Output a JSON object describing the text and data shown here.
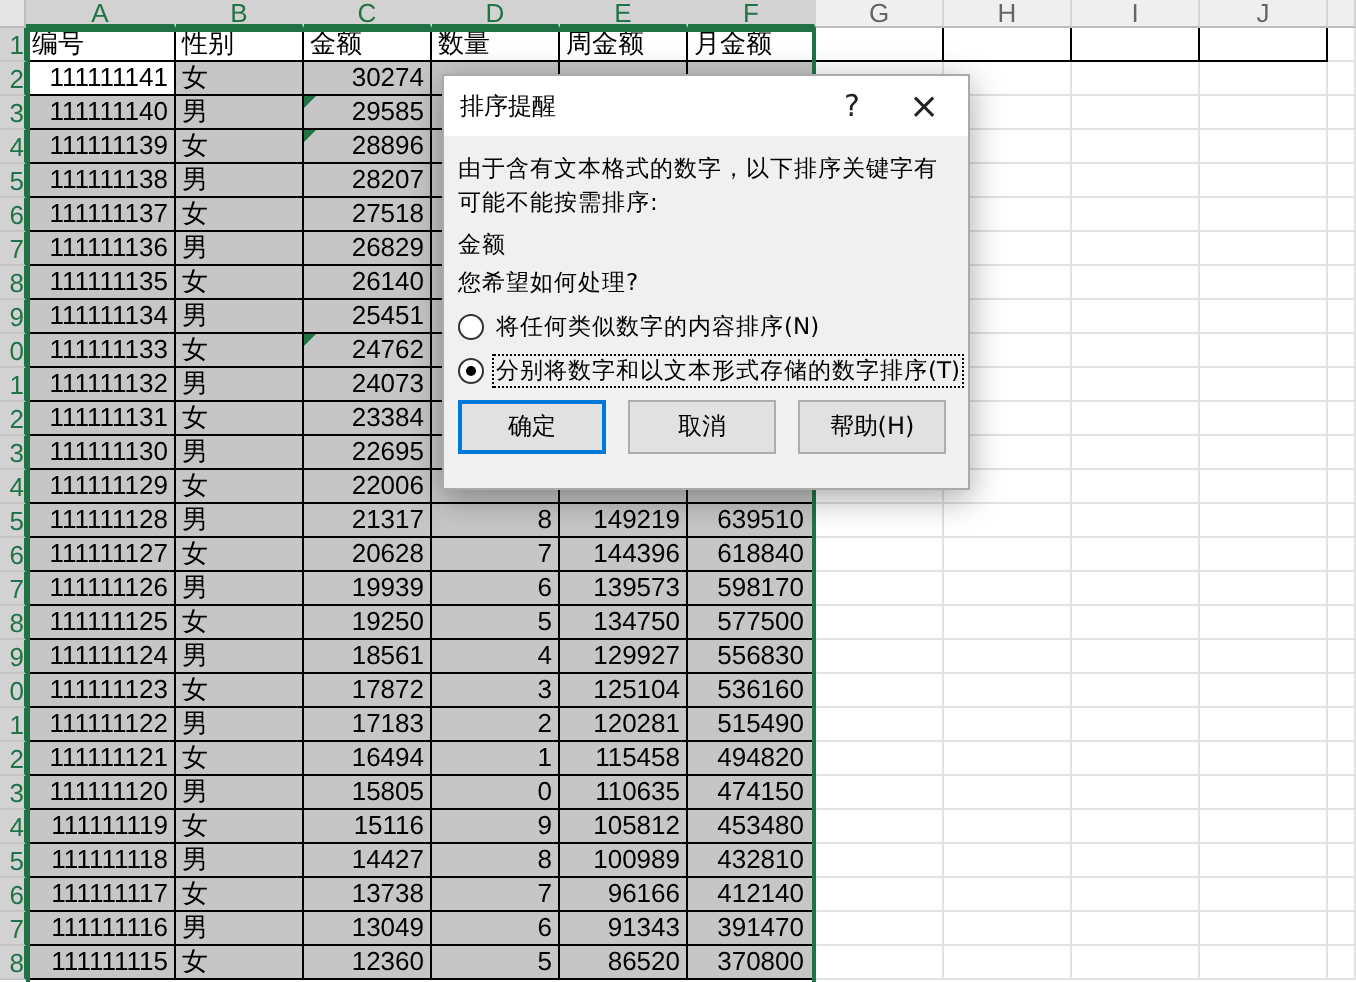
{
  "sheet": {
    "columns": [
      {
        "label": "A",
        "selected": true
      },
      {
        "label": "B",
        "selected": true
      },
      {
        "label": "C",
        "selected": true
      },
      {
        "label": "D",
        "selected": true
      },
      {
        "label": "E",
        "selected": true
      },
      {
        "label": "F",
        "selected": true
      },
      {
        "label": "G",
        "selected": false
      },
      {
        "label": "H",
        "selected": false
      },
      {
        "label": "I",
        "selected": false
      },
      {
        "label": "J",
        "selected": false
      }
    ],
    "header": {
      "row_number": "1",
      "cells": [
        "编号",
        "性别",
        "金额",
        "数量",
        "周金额",
        "月金额"
      ]
    },
    "rows": [
      {
        "row_number": "2",
        "active": true,
        "cells": [
          "111111141",
          "女",
          "30274"
        ],
        "text_number": false
      },
      {
        "row_number": "3",
        "active": false,
        "cells": [
          "111111140",
          "男",
          "29585"
        ],
        "text_number": true
      },
      {
        "row_number": "4",
        "active": false,
        "cells": [
          "111111139",
          "女",
          "28896"
        ],
        "text_number": true
      },
      {
        "row_number": "5",
        "active": false,
        "cells": [
          "111111138",
          "男",
          "28207"
        ],
        "text_number": false
      },
      {
        "row_number": "6",
        "active": false,
        "cells": [
          "111111137",
          "女",
          "27518"
        ],
        "text_number": false
      },
      {
        "row_number": "7",
        "active": false,
        "cells": [
          "111111136",
          "男",
          "26829"
        ],
        "text_number": false
      },
      {
        "row_number": "8",
        "active": false,
        "cells": [
          "111111135",
          "女",
          "26140"
        ],
        "text_number": false
      },
      {
        "row_number": "9",
        "active": false,
        "cells": [
          "111111134",
          "男",
          "25451"
        ],
        "text_number": false
      },
      {
        "row_number": "0",
        "active": false,
        "cells": [
          "111111133",
          "女",
          "24762"
        ],
        "text_number": true
      },
      {
        "row_number": "1",
        "active": false,
        "cells": [
          "111111132",
          "男",
          "24073"
        ],
        "text_number": false
      },
      {
        "row_number": "2",
        "active": false,
        "cells": [
          "111111131",
          "女",
          "23384"
        ],
        "text_number": false
      },
      {
        "row_number": "3",
        "active": false,
        "cells": [
          "111111130",
          "男",
          "22695"
        ],
        "text_number": false
      },
      {
        "row_number": "4",
        "active": false,
        "cells": [
          "111111129",
          "女",
          "22006"
        ],
        "text_number": false
      },
      {
        "row_number": "5",
        "active": false,
        "cells": [
          "111111128",
          "男",
          "21317",
          "8",
          "149219",
          "639510"
        ],
        "text_number": false
      },
      {
        "row_number": "6",
        "active": false,
        "cells": [
          "111111127",
          "女",
          "20628",
          "7",
          "144396",
          "618840"
        ],
        "text_number": false
      },
      {
        "row_number": "7",
        "active": false,
        "cells": [
          "111111126",
          "男",
          "19939",
          "6",
          "139573",
          "598170"
        ],
        "text_number": false
      },
      {
        "row_number": "8",
        "active": false,
        "cells": [
          "111111125",
          "女",
          "19250",
          "5",
          "134750",
          "577500"
        ],
        "text_number": false
      },
      {
        "row_number": "9",
        "active": false,
        "cells": [
          "111111124",
          "男",
          "18561",
          "4",
          "129927",
          "556830"
        ],
        "text_number": false
      },
      {
        "row_number": "0",
        "active": false,
        "cells": [
          "111111123",
          "女",
          "17872",
          "3",
          "125104",
          "536160"
        ],
        "text_number": false
      },
      {
        "row_number": "1",
        "active": false,
        "cells": [
          "111111122",
          "男",
          "17183",
          "2",
          "120281",
          "515490"
        ],
        "text_number": false
      },
      {
        "row_number": "2",
        "active": false,
        "cells": [
          "111111121",
          "女",
          "16494",
          "1",
          "115458",
          "494820"
        ],
        "text_number": false
      },
      {
        "row_number": "3",
        "active": false,
        "cells": [
          "111111120",
          "男",
          "15805",
          "0",
          "110635",
          "474150"
        ],
        "text_number": false
      },
      {
        "row_number": "4",
        "active": false,
        "cells": [
          "111111119",
          "女",
          "15116",
          "9",
          "105812",
          "453480"
        ],
        "text_number": false
      },
      {
        "row_number": "5",
        "active": false,
        "cells": [
          "111111118",
          "男",
          "14427",
          "8",
          "100989",
          "432810"
        ],
        "text_number": false
      },
      {
        "row_number": "6",
        "active": false,
        "cells": [
          "111111117",
          "女",
          "13738",
          "7",
          "96166",
          "412140"
        ],
        "text_number": false
      },
      {
        "row_number": "7",
        "active": false,
        "cells": [
          "111111116",
          "男",
          "13049",
          "6",
          "91343",
          "391470"
        ],
        "text_number": false
      },
      {
        "row_number": "8",
        "active": false,
        "cells": [
          "111111115",
          "女",
          "12360",
          "5",
          "86520",
          "370800"
        ],
        "text_number": false
      }
    ]
  },
  "dialog": {
    "title": "排序提醒",
    "help": "?",
    "close": "×",
    "message": "由于含有文本格式的数字，以下排序关键字有可能不能按需排序:",
    "key": "金额",
    "question": "您希望如何处理?",
    "options": [
      {
        "label": "将任何类似数字的内容排序(N)",
        "selected": false,
        "focused": false
      },
      {
        "label": "分别将数字和以文本形式存储的数字排序(T)",
        "selected": true,
        "focused": true
      }
    ],
    "buttons": [
      {
        "label": "确定",
        "default": true
      },
      {
        "label": "取消",
        "default": false
      },
      {
        "label": "帮助(H)",
        "default": false
      }
    ]
  }
}
